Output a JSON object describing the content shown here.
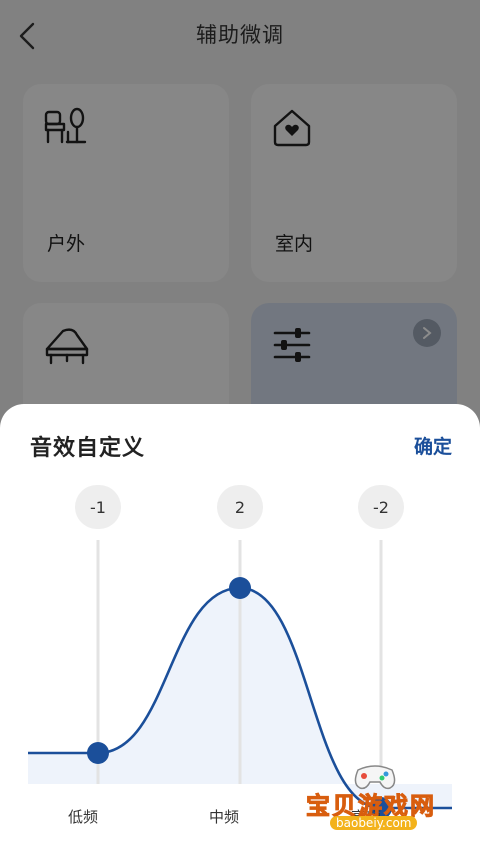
{
  "header": {
    "title": "辅助微调"
  },
  "cards": [
    {
      "label": "户外",
      "icon": "outdoor-icon"
    },
    {
      "label": "室内",
      "icon": "house-heart-icon"
    },
    {
      "label": "",
      "icon": "piano-icon"
    },
    {
      "label": "",
      "icon": "sliders-icon",
      "selected": true
    }
  ],
  "sheet": {
    "title": "音效自定义",
    "confirm_label": "确定",
    "bands": [
      {
        "name": "低频",
        "value": "-1",
        "level": -1
      },
      {
        "name": "中频",
        "value": "2",
        "level": 2
      },
      {
        "name": "高频",
        "value": "-2",
        "level": -2
      }
    ]
  },
  "watermark": {
    "text": "宝贝游戏网",
    "url": "baobeiy.com"
  },
  "colors": {
    "accent": "#1b4f9a",
    "curve": "#1b4f9a",
    "fill": "#eef3fb"
  }
}
